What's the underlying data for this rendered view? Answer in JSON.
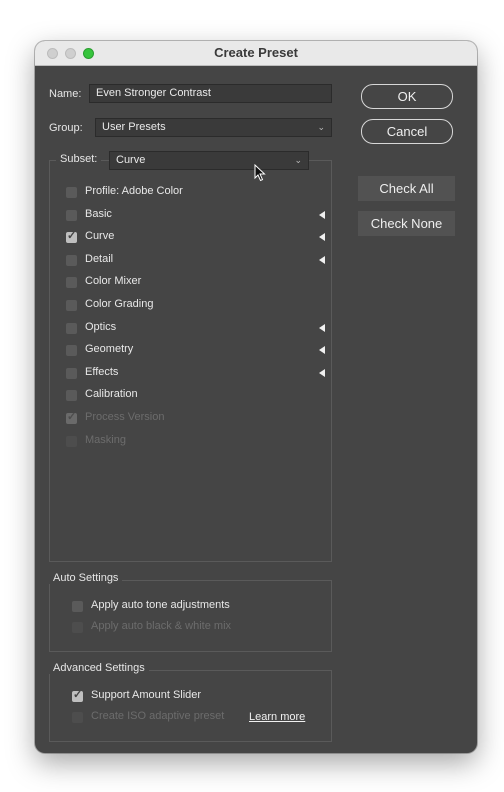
{
  "window": {
    "title": "Create Preset"
  },
  "form": {
    "name_label": "Name:",
    "name_value": "Even Stronger Contrast",
    "group_label": "Group:",
    "group_value": "User Presets",
    "subset_label": "Subset:",
    "subset_value": "Curve"
  },
  "buttons": {
    "ok": "OK",
    "cancel": "Cancel",
    "check_all": "Check All",
    "check_none": "Check None"
  },
  "subset_items": [
    {
      "label": "Profile: Adobe Color",
      "checked": false,
      "disabled": false,
      "submenu": false
    },
    {
      "label": "Basic",
      "checked": false,
      "disabled": false,
      "submenu": true
    },
    {
      "label": "Curve",
      "checked": true,
      "disabled": false,
      "submenu": true
    },
    {
      "label": "Detail",
      "checked": false,
      "disabled": false,
      "submenu": true
    },
    {
      "label": "Color Mixer",
      "checked": false,
      "disabled": false,
      "submenu": false
    },
    {
      "label": "Color Grading",
      "checked": false,
      "disabled": false,
      "submenu": false
    },
    {
      "label": "Optics",
      "checked": false,
      "disabled": false,
      "submenu": true
    },
    {
      "label": "Geometry",
      "checked": false,
      "disabled": false,
      "submenu": true
    },
    {
      "label": "Effects",
      "checked": false,
      "disabled": false,
      "submenu": true
    },
    {
      "label": "Calibration",
      "checked": false,
      "disabled": false,
      "submenu": false
    },
    {
      "label": "Process Version",
      "checked": true,
      "disabled": true,
      "submenu": false
    },
    {
      "label": "Masking",
      "checked": false,
      "disabled": true,
      "submenu": false
    }
  ],
  "auto_settings": {
    "title": "Auto Settings",
    "items": [
      {
        "label": "Apply auto tone adjustments",
        "checked": false,
        "disabled": false
      },
      {
        "label": "Apply auto black & white mix",
        "checked": false,
        "disabled": true
      }
    ]
  },
  "advanced_settings": {
    "title": "Advanced Settings",
    "items": [
      {
        "label": "Support Amount Slider",
        "checked": true,
        "disabled": false
      },
      {
        "label": "Create ISO adaptive preset",
        "checked": false,
        "disabled": true
      }
    ],
    "learn_more": "Learn more"
  }
}
